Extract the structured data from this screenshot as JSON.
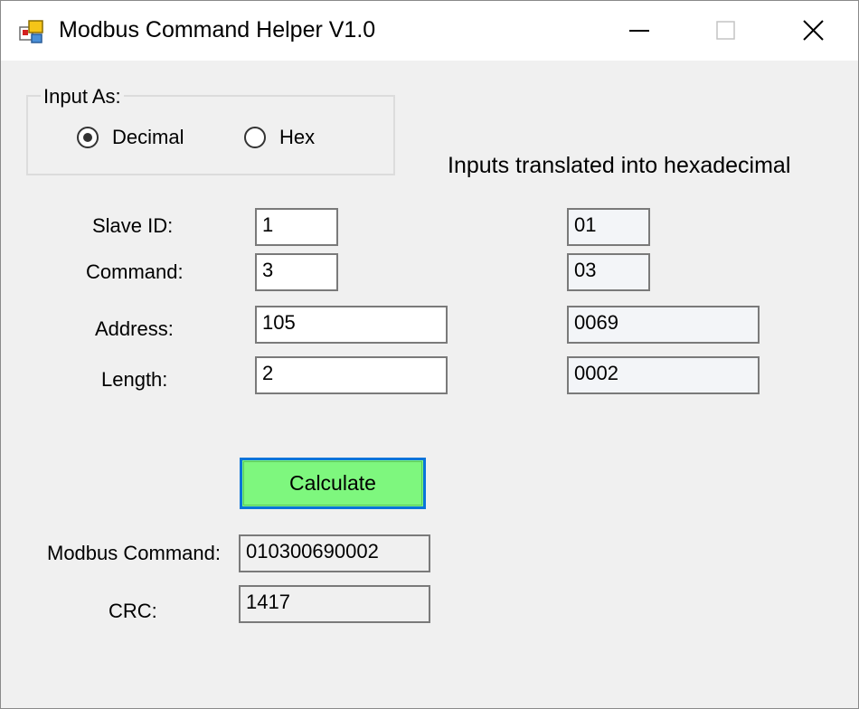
{
  "window": {
    "title": "Modbus Command Helper V1.0"
  },
  "input_mode": {
    "legend": "Input As:",
    "options": [
      {
        "label": "Decimal",
        "selected": true
      },
      {
        "label": "Hex",
        "selected": false
      }
    ]
  },
  "hex_heading": "Inputs translated into hexadecimal",
  "fields": {
    "slave_id": {
      "label": "Slave ID:",
      "value": "1",
      "hex": "01"
    },
    "command": {
      "label": "Command:",
      "value": "3",
      "hex": "03"
    },
    "address": {
      "label": "Address:",
      "value": "105",
      "hex": "0069"
    },
    "length": {
      "label": "Length:",
      "value": "2",
      "hex": "0002"
    }
  },
  "calculate_label": "Calculate",
  "results": {
    "modbus_command": {
      "label": "Modbus Command:",
      "value": "010300690002"
    },
    "crc": {
      "label": "CRC:",
      "value": "1417"
    }
  },
  "colors": {
    "calculate_bg": "#7ef77e",
    "calculate_border": "#0a74d9"
  }
}
